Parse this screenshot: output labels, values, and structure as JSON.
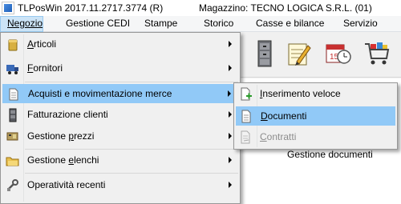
{
  "window": {
    "title": "TLPosWin 2017.11.2717.3774 (R)",
    "magazzino": "Magazzino: TECNO LOGICA S.R.L. (01)"
  },
  "menubar": [
    "Negozio",
    "Gestione CEDI",
    "Stampe",
    "Storico",
    "Casse e bilance",
    "Servizio"
  ],
  "menubar_active": "Negozio",
  "dropdown": {
    "items": [
      {
        "label": "Articoli",
        "accel": "A",
        "rest": "rticoli",
        "icon": "box-icon",
        "has_submenu": true
      },
      {
        "label": "Fornitori",
        "accel": "F",
        "rest": "ornitori",
        "icon": "truck-icon",
        "has_submenu": true
      },
      {
        "label": "Acquisti e movimentazione merce",
        "icon": "document-icon",
        "has_submenu": true,
        "highlighted": true
      },
      {
        "label": "Fatturazione clienti",
        "icon": "cabinet-icon",
        "has_submenu": true
      },
      {
        "label": "Gestione prezzi",
        "pre": "Gestione ",
        "accel": "p",
        "rest": "rezzi",
        "icon": "price-tag-icon",
        "has_submenu": true
      },
      {
        "label": "Gestione elenchi",
        "pre": "Gestione ",
        "accel": "e",
        "rest": "lenchi",
        "icon": "folder-icon",
        "has_submenu": true
      },
      {
        "label": "Operatività recenti",
        "icon": "recent-tools-icon",
        "has_submenu": true
      }
    ]
  },
  "submenu": {
    "items": [
      {
        "label": "Inserimento veloce",
        "accel": "I",
        "rest": "nserimento veloce",
        "icon": "add-document-icon",
        "enabled": true
      },
      {
        "label": "Documenti",
        "accel": "D",
        "rest": "ocumenti",
        "icon": "document-icon",
        "enabled": true,
        "highlighted": true
      },
      {
        "label": "Contratti",
        "accel": "C",
        "rest": "ontratti",
        "icon": "contract-icon",
        "enabled": false
      }
    ]
  },
  "content_peek": "Gestione documenti",
  "colors": {
    "highlight": "#91c9f7",
    "menu_bg": "#f0f0f0",
    "menubar_active": "#cce4f7"
  }
}
